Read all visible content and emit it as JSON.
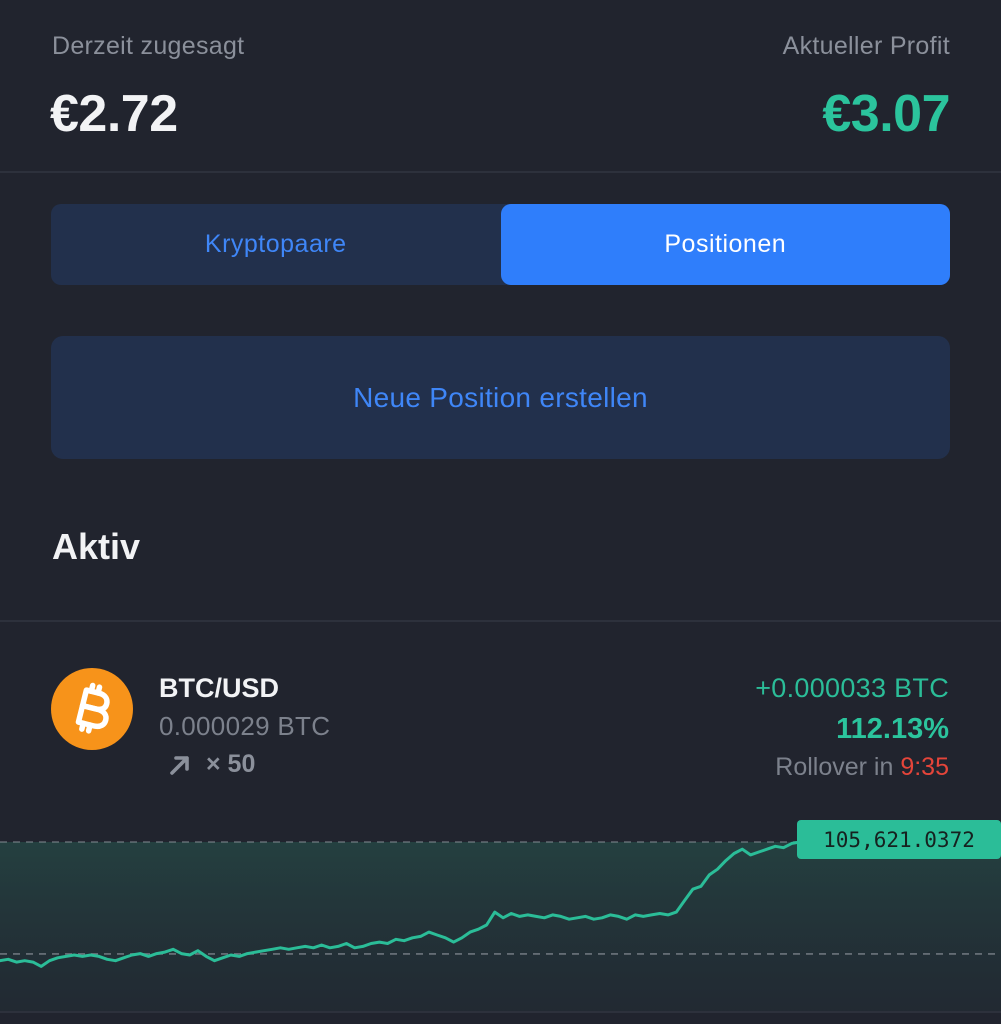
{
  "summary": {
    "committed_label": "Derzeit zugesagt",
    "committed_value": "€2.72",
    "profit_label": "Aktueller Profit",
    "profit_value": "€3.07",
    "profit_color": "#2bc49d"
  },
  "tabs": [
    {
      "label": "Kryptopaare",
      "active": false
    },
    {
      "label": "Positionen",
      "active": true
    }
  ],
  "new_position_label": "Neue Position erstellen",
  "section_title": "Aktiv",
  "position": {
    "icon": "bitcoin-icon",
    "pair": "BTC/USD",
    "amount": "0.000029 BTC",
    "direction_icon": "arrow-up-right-icon",
    "leverage": "× 50",
    "profit_btc": "+0.000033 BTC",
    "profit_pct": "112.13%",
    "rollover_label": "Rollover in",
    "rollover_time": "9:35"
  },
  "chart": {
    "current_price": "105,621.0372",
    "line_color": "#2bbd98",
    "entry_level": 0.147,
    "current_level": 0.93,
    "series": [
      0.1,
      0.11,
      0.09,
      0.1,
      0.09,
      0.06,
      0.1,
      0.12,
      0.13,
      0.14,
      0.13,
      0.14,
      0.13,
      0.11,
      0.1,
      0.12,
      0.14,
      0.15,
      0.13,
      0.15,
      0.16,
      0.18,
      0.15,
      0.14,
      0.17,
      0.13,
      0.1,
      0.12,
      0.14,
      0.13,
      0.15,
      0.16,
      0.17,
      0.18,
      0.19,
      0.18,
      0.19,
      0.2,
      0.19,
      0.21,
      0.19,
      0.2,
      0.22,
      0.19,
      0.2,
      0.22,
      0.23,
      0.22,
      0.25,
      0.24,
      0.26,
      0.27,
      0.3,
      0.28,
      0.26,
      0.23,
      0.26,
      0.3,
      0.32,
      0.35,
      0.44,
      0.4,
      0.43,
      0.41,
      0.42,
      0.41,
      0.4,
      0.42,
      0.41,
      0.39,
      0.4,
      0.41,
      0.39,
      0.4,
      0.42,
      0.41,
      0.39,
      0.42,
      0.41,
      0.42,
      0.43,
      0.42,
      0.44,
      0.52,
      0.6,
      0.62,
      0.7,
      0.74,
      0.8,
      0.85,
      0.88,
      0.84,
      0.86,
      0.88,
      0.9,
      0.89,
      0.92,
      0.93
    ]
  }
}
